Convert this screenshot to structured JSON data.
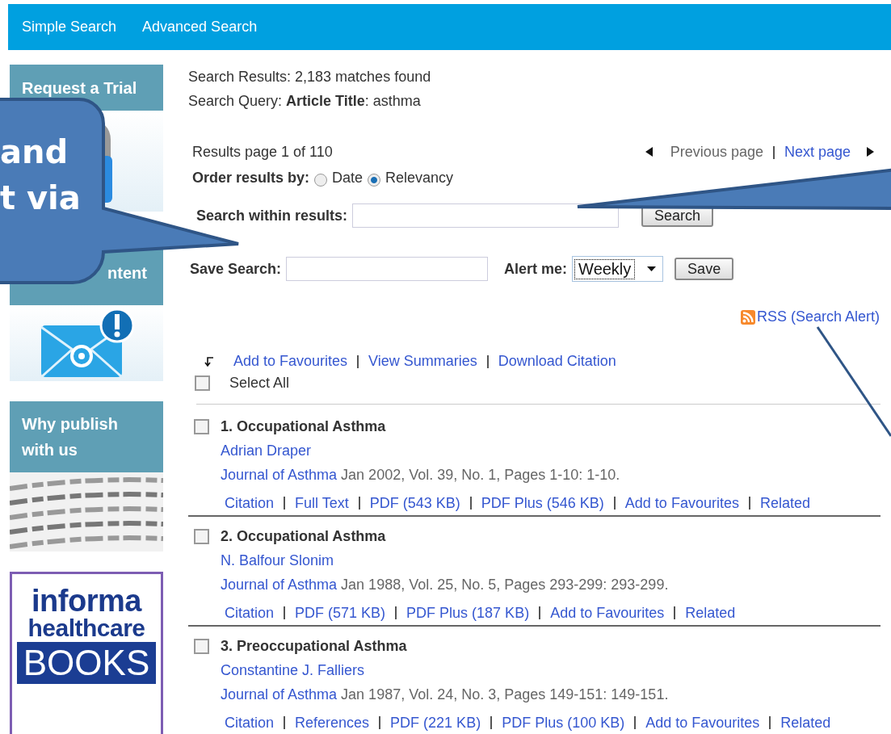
{
  "nav": [
    {
      "label": "Simple Search"
    },
    {
      "label": "Advanced Search"
    }
  ],
  "sidebar": [
    {
      "kind": "trial",
      "title_lines": [
        "Request a Trial"
      ]
    },
    {
      "kind": "alerts",
      "title_lines": [
        "ntent"
      ]
    },
    {
      "kind": "publish",
      "title_lines": [
        "Why publish",
        "with us"
      ]
    },
    {
      "kind": "logo",
      "title_lines": [
        "informa",
        "healthcare",
        "BOOKS"
      ]
    }
  ],
  "summary": {
    "results": "Search Results: 2,183 matches found",
    "query": "Search Query: **Article Title**: asthma"
  },
  "paging": {
    "page_info": "Results page 1 of 110",
    "previous": {
      "label": "Previous page",
      "disabled": true
    },
    "next": {
      "label": "Next page",
      "disabled": false
    }
  },
  "order": {
    "label": "Order results by:",
    "options": [
      {
        "label": "Date",
        "selected": false
      },
      {
        "label": "Relevancy",
        "selected": true
      }
    ]
  },
  "search_within": {
    "label": "Search within results:",
    "button": "Search"
  },
  "save_search": {
    "label": "Save Search:",
    "alert_label": "Alert me:",
    "alert_value": "Weekly",
    "button": "Save"
  },
  "rss": "RSS (Search Alert)",
  "bulk_actions": [
    "Add to Favourites",
    "View Summaries",
    "Download Citation"
  ],
  "select_all": {
    "label": "Select All",
    "checked": false
  },
  "results": [
    {
      "title": "1. Occupational Asthma",
      "checked": false,
      "author": "Adrian Draper",
      "journal": "Journal of Asthma",
      "details": " Jan 2002, Vol. 39, No. 1, Pages 1-10: 1-10.",
      "links": [
        "Citation",
        "Full Text",
        "PDF (543 KB)",
        "PDF Plus (546 KB)",
        "Add to Favourites",
        "Related"
      ]
    },
    {
      "title": "2. Occupational Asthma",
      "checked": false,
      "author": "N. Balfour Slonim",
      "journal": "Journal of Asthma",
      "details": " Jan 1988, Vol. 25, No. 5, Pages 293-299: 293-299.",
      "links": [
        "Citation",
        "PDF (571 KB)",
        "PDF Plus (187 KB)",
        "Add to Favourites",
        "Related"
      ]
    },
    {
      "title": "3. Preoccupational Asthma",
      "checked": false,
      "author": "Constantine J. Falliers",
      "journal": "Journal of Asthma",
      "details": " Jan 1987, Vol. 24, No. 3, Pages 149-151: 149-151.",
      "links": [
        "Citation",
        "References",
        "PDF (221 KB)",
        "PDF Plus (100 KB)",
        "Add to Favourites",
        "Related"
      ]
    }
  ],
  "callout": {
    "lines": [
      "and",
      "t via"
    ]
  }
}
